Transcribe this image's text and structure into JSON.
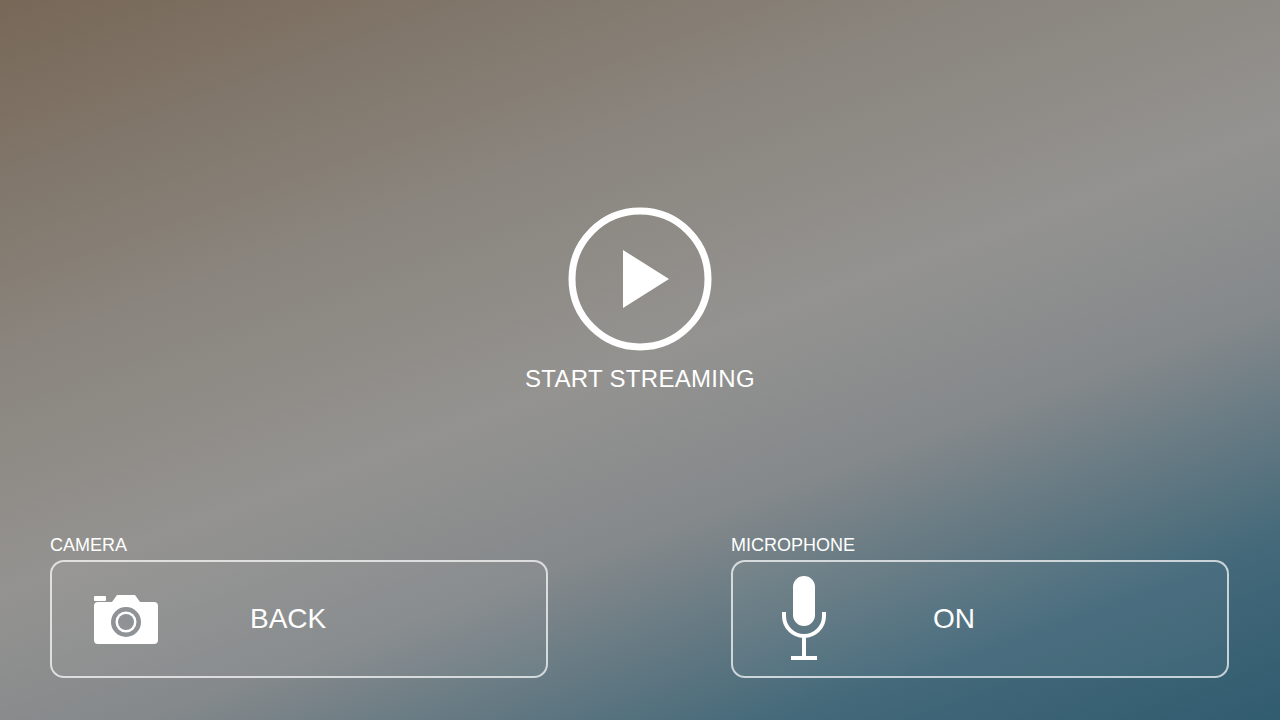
{
  "stream_button": {
    "label": "START STREAMING"
  },
  "controls": [
    {
      "title": "CAMERA",
      "value": "BACK",
      "kind": "camera"
    },
    {
      "title": "MICROPHONE",
      "value": "ON",
      "kind": "microphone"
    }
  ]
}
